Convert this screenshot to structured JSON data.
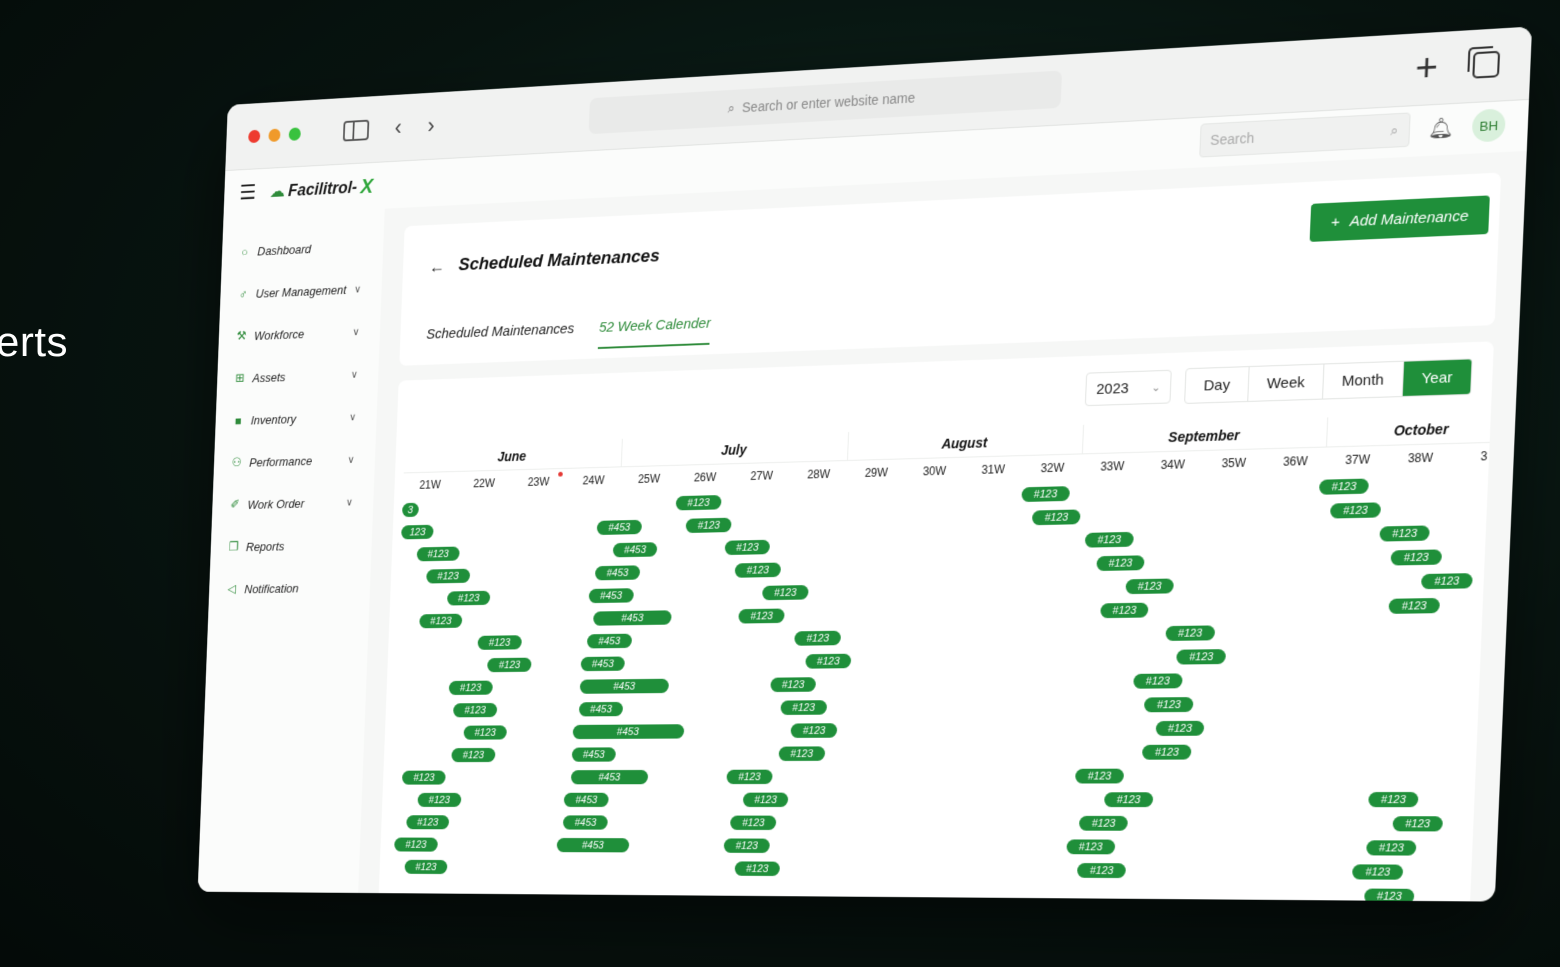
{
  "background_text": "erts",
  "browser": {
    "url_placeholder": "Search or enter website name"
  },
  "app": {
    "brand": "Facilitrol-",
    "brand_x": "X",
    "search_placeholder": "Search",
    "avatar_initials": "BH"
  },
  "sidebar": {
    "items": [
      {
        "label": "Dashboard",
        "icon": "dashboard-icon",
        "has_children": false
      },
      {
        "label": "User Management",
        "icon": "user-icon",
        "has_children": true
      },
      {
        "label": "Workforce",
        "icon": "workforce-icon",
        "has_children": true
      },
      {
        "label": "Assets",
        "icon": "assets-icon",
        "has_children": true
      },
      {
        "label": "Inventory",
        "icon": "inventory-icon",
        "has_children": true
      },
      {
        "label": "Performance",
        "icon": "performance-icon",
        "has_children": true
      },
      {
        "label": "Work Order",
        "icon": "work-order-icon",
        "has_children": true
      },
      {
        "label": "Reports",
        "icon": "reports-icon",
        "has_children": false
      },
      {
        "label": "Notification",
        "icon": "notification-icon",
        "has_children": false
      }
    ]
  },
  "page": {
    "title": "Scheduled Maintenances",
    "add_button": "Add Maintenance",
    "tabs": [
      {
        "label": "Scheduled Maintenances",
        "active": false
      },
      {
        "label": "52 Week Calender",
        "active": true
      }
    ]
  },
  "calendar": {
    "year": "2023",
    "views": [
      {
        "label": "Day",
        "active": false
      },
      {
        "label": "Week",
        "active": false
      },
      {
        "label": "Month",
        "active": false
      },
      {
        "label": "Year",
        "active": true
      }
    ],
    "months": [
      {
        "label": "June",
        "weeks": 4
      },
      {
        "label": "July",
        "weeks": 4
      },
      {
        "label": "August",
        "weeks": 4
      },
      {
        "label": "September",
        "weeks": 4
      },
      {
        "label": "October",
        "weeks": 3
      }
    ],
    "weeks": [
      "21W",
      "22W",
      "23W",
      "24W",
      "25W",
      "26W",
      "27W",
      "28W",
      "29W",
      "30W",
      "31W",
      "32W",
      "33W",
      "34W",
      "35W",
      "36W",
      "37W",
      "38W",
      "3"
    ],
    "marked_week": "23W",
    "accent_color": "#1f8f3a",
    "events": [
      {
        "label": "3",
        "week": -0.2,
        "span": 0.3,
        "row": 0
      },
      {
        "label": "123",
        "week": -0.3,
        "span": 0.6,
        "row": 1
      },
      {
        "label": "#123",
        "week": 0.3,
        "span": 0.8,
        "row": 2
      },
      {
        "label": "#123",
        "week": 0.5,
        "span": 0.8,
        "row": 3
      },
      {
        "label": "#123",
        "week": 0.9,
        "span": 0.8,
        "row": 4
      },
      {
        "label": "#123",
        "week": 0.4,
        "span": 0.8,
        "row": 5
      },
      {
        "label": "#123",
        "week": 1.5,
        "span": 0.8,
        "row": 6
      },
      {
        "label": "#123",
        "week": 1.7,
        "span": 0.8,
        "row": 7
      },
      {
        "label": "#123",
        "week": 1.0,
        "span": 0.8,
        "row": 8
      },
      {
        "label": "#123",
        "week": 1.1,
        "span": 0.8,
        "row": 9
      },
      {
        "label": "#123",
        "week": 1.3,
        "span": 0.8,
        "row": 10
      },
      {
        "label": "#123",
        "week": 1.1,
        "span": 0.8,
        "row": 11
      },
      {
        "label": "#123",
        "week": 0.2,
        "span": 0.8,
        "row": 12
      },
      {
        "label": "#123",
        "week": 0.5,
        "span": 0.8,
        "row": 13
      },
      {
        "label": "#123",
        "week": 0.3,
        "span": 0.8,
        "row": 14
      },
      {
        "label": "#123",
        "week": 0.1,
        "span": 0.8,
        "row": 15
      },
      {
        "label": "#123",
        "week": 0.3,
        "span": 0.8,
        "row": 16
      },
      {
        "label": "#453",
        "week": 3.6,
        "span": 0.8,
        "row": 1
      },
      {
        "label": "#453",
        "week": 3.9,
        "span": 0.8,
        "row": 2
      },
      {
        "label": "#453",
        "week": 3.6,
        "span": 0.8,
        "row": 3
      },
      {
        "label": "#453",
        "week": 3.5,
        "span": 0.8,
        "row": 4
      },
      {
        "label": "#453",
        "week": 3.6,
        "span": 1.4,
        "row": 5
      },
      {
        "label": "#453",
        "week": 3.5,
        "span": 0.8,
        "row": 6
      },
      {
        "label": "#453",
        "week": 3.4,
        "span": 0.8,
        "row": 7
      },
      {
        "label": "#453",
        "week": 3.4,
        "span": 1.6,
        "row": 8
      },
      {
        "label": "#453",
        "week": 3.4,
        "span": 0.8,
        "row": 9
      },
      {
        "label": "#453",
        "week": 3.3,
        "span": 2.0,
        "row": 10
      },
      {
        "label": "#453",
        "week": 3.3,
        "span": 0.8,
        "row": 11
      },
      {
        "label": "#453",
        "week": 3.3,
        "span": 1.4,
        "row": 12
      },
      {
        "label": "#453",
        "week": 3.2,
        "span": 0.8,
        "row": 13
      },
      {
        "label": "#453",
        "week": 3.2,
        "span": 0.8,
        "row": 14
      },
      {
        "label": "#453",
        "week": 3.1,
        "span": 1.3,
        "row": 15
      },
      {
        "label": "#123",
        "week": 5.0,
        "span": 0.8,
        "row": 0
      },
      {
        "label": "#123",
        "week": 5.2,
        "span": 0.8,
        "row": 1
      },
      {
        "label": "#123",
        "week": 5.9,
        "span": 0.8,
        "row": 2
      },
      {
        "label": "#123",
        "week": 6.1,
        "span": 0.8,
        "row": 3
      },
      {
        "label": "#123",
        "week": 6.6,
        "span": 0.8,
        "row": 4
      },
      {
        "label": "#123",
        "week": 6.2,
        "span": 0.8,
        "row": 5
      },
      {
        "label": "#123",
        "week": 7.2,
        "span": 0.8,
        "row": 6
      },
      {
        "label": "#123",
        "week": 7.4,
        "span": 0.8,
        "row": 7
      },
      {
        "label": "#123",
        "week": 6.8,
        "span": 0.8,
        "row": 8
      },
      {
        "label": "#123",
        "week": 7.0,
        "span": 0.8,
        "row": 9
      },
      {
        "label": "#123",
        "week": 7.2,
        "span": 0.8,
        "row": 10
      },
      {
        "label": "#123",
        "week": 7.0,
        "span": 0.8,
        "row": 11
      },
      {
        "label": "#123",
        "week": 6.1,
        "span": 0.8,
        "row": 12
      },
      {
        "label": "#123",
        "week": 6.4,
        "span": 0.8,
        "row": 13
      },
      {
        "label": "#123",
        "week": 6.2,
        "span": 0.8,
        "row": 14
      },
      {
        "label": "#123",
        "week": 6.1,
        "span": 0.8,
        "row": 15
      },
      {
        "label": "#123",
        "week": 6.3,
        "span": 0.8,
        "row": 16
      },
      {
        "label": "#123",
        "week": 11.0,
        "span": 0.8,
        "row": 0
      },
      {
        "label": "#123",
        "week": 11.2,
        "span": 0.8,
        "row": 1
      },
      {
        "label": "#123",
        "week": 12.1,
        "span": 0.8,
        "row": 2
      },
      {
        "label": "#123",
        "week": 12.3,
        "span": 0.8,
        "row": 3
      },
      {
        "label": "#123",
        "week": 12.8,
        "span": 0.8,
        "row": 4
      },
      {
        "label": "#123",
        "week": 12.4,
        "span": 0.8,
        "row": 5
      },
      {
        "label": "#123",
        "week": 13.5,
        "span": 0.8,
        "row": 6
      },
      {
        "label": "#123",
        "week": 13.7,
        "span": 0.8,
        "row": 7
      },
      {
        "label": "#123",
        "week": 13.0,
        "span": 0.8,
        "row": 8
      },
      {
        "label": "#123",
        "week": 13.2,
        "span": 0.8,
        "row": 9
      },
      {
        "label": "#123",
        "week": 13.4,
        "span": 0.8,
        "row": 10
      },
      {
        "label": "#123",
        "week": 13.2,
        "span": 0.8,
        "row": 11
      },
      {
        "label": "#123",
        "week": 12.1,
        "span": 0.8,
        "row": 12
      },
      {
        "label": "#123",
        "week": 12.6,
        "span": 0.8,
        "row": 13
      },
      {
        "label": "#123",
        "week": 12.2,
        "span": 0.8,
        "row": 14
      },
      {
        "label": "#123",
        "week": 12.0,
        "span": 0.8,
        "row": 15
      },
      {
        "label": "#123",
        "week": 12.2,
        "span": 0.8,
        "row": 16
      },
      {
        "label": "#123",
        "week": 15.9,
        "span": 0.8,
        "row": 0
      },
      {
        "label": "#123",
        "week": 16.1,
        "span": 0.8,
        "row": 1
      },
      {
        "label": "#123",
        "week": 16.9,
        "span": 0.8,
        "row": 2
      },
      {
        "label": "#123",
        "week": 17.1,
        "span": 0.8,
        "row": 3
      },
      {
        "label": "#123",
        "week": 17.6,
        "span": 0.8,
        "row": 4
      },
      {
        "label": "#123",
        "week": 17.1,
        "span": 0.8,
        "row": 5
      },
      {
        "label": "#123",
        "week": 16.9,
        "span": 0.8,
        "row": 13
      },
      {
        "label": "#123",
        "week": 17.3,
        "span": 0.8,
        "row": 14
      },
      {
        "label": "#123",
        "week": 16.9,
        "span": 0.8,
        "row": 15
      },
      {
        "label": "#123",
        "week": 16.7,
        "span": 0.8,
        "row": 16
      },
      {
        "label": "#123",
        "week": 16.9,
        "span": 0.8,
        "row": 17
      }
    ]
  }
}
